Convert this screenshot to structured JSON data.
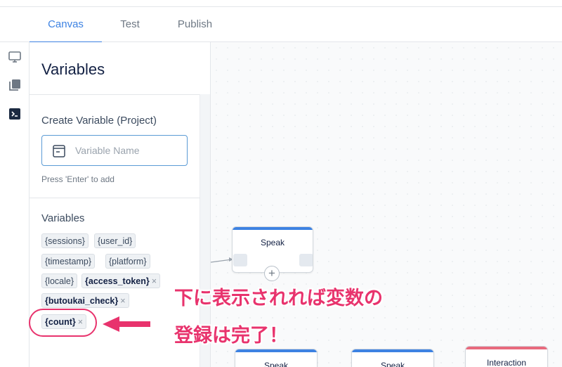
{
  "tabs": [
    {
      "label": "Canvas",
      "active": true
    },
    {
      "label": "Test",
      "active": false
    },
    {
      "label": "Publish",
      "active": false
    }
  ],
  "rail": {
    "icons": [
      "monitor-icon",
      "library-icon",
      "terminal-icon"
    ]
  },
  "panel": {
    "title": "Variables",
    "create": {
      "title": "Create Variable (Project)",
      "placeholder": "Variable Name",
      "hint": "Press 'Enter' to add"
    },
    "variables": {
      "title": "Variables",
      "chips": [
        {
          "label": "{sessions}",
          "removable": false
        },
        {
          "label": "{user_id}",
          "removable": false
        },
        {
          "label": "{timestamp}",
          "removable": false
        },
        {
          "label": "{platform}",
          "removable": false
        },
        {
          "label": "{locale}",
          "removable": false
        },
        {
          "label": "{access_token}",
          "removable": true
        },
        {
          "label": "{butoukai_check}",
          "removable": true
        },
        {
          "label": "{count}",
          "removable": true
        }
      ],
      "remove_glyph": "×"
    }
  },
  "canvas": {
    "nodes": [
      {
        "label": "Speak",
        "color": "#3d82e2"
      },
      {
        "label": "Speak",
        "color": "#3d82e2"
      },
      {
        "label": "Speak",
        "color": "#3d82e2"
      },
      {
        "label": "Interaction",
        "color": "#e86a7d"
      }
    ],
    "plus_glyph": "+"
  },
  "annotation": {
    "line1": "下に表示されれば変数の",
    "line2": "登録は完了！",
    "color": "#e8336d"
  },
  "colors": {
    "accent": "#3d82e2",
    "annotation": "#e8336d"
  }
}
